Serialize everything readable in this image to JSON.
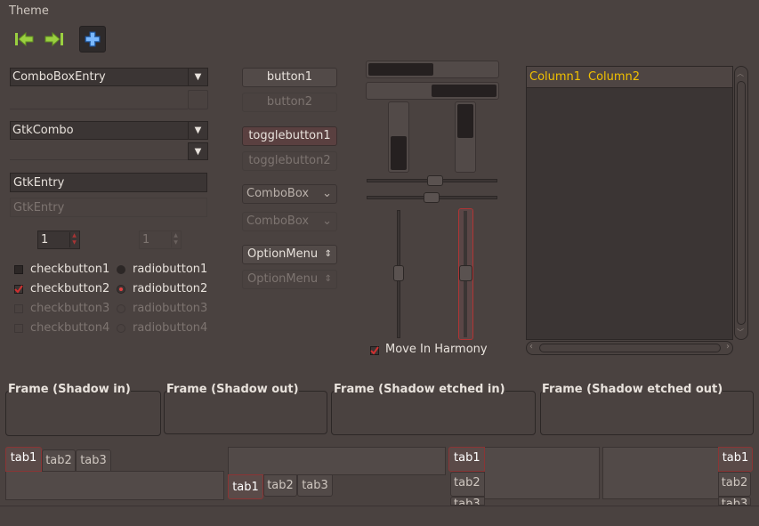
{
  "window": {
    "title": "Theme"
  },
  "toolbar": {
    "back_icon": "go-first-icon",
    "forward_icon": "go-last-icon",
    "add_icon": "add-icon"
  },
  "left": {
    "combo_entry_value": "ComboBoxEntry",
    "gtk_combo_value": "GtkCombo",
    "entry1_value": "GtkEntry",
    "entry2_value": "GtkEntry",
    "spin1_value": "1",
    "spin2_value": "1",
    "checks": [
      "checkbutton1",
      "checkbutton2",
      "checkbutton3",
      "checkbutton4"
    ],
    "radios": [
      "radiobutton1",
      "radiobutton2",
      "radiobutton3",
      "radiobutton4"
    ]
  },
  "middle": {
    "button1": "button1",
    "button2": "button2",
    "toggle1": "togglebutton1",
    "toggle2": "togglebutton2",
    "combo1": "ComboBox",
    "combo2": "ComboBox",
    "option1": "OptionMenu",
    "option2": "OptionMenu"
  },
  "scales": {
    "harmony_label": "Move In Harmony",
    "progress_h1": 0.5,
    "progress_h2": 0.5,
    "progress_v1": 0.5,
    "progress_v2": 0.5
  },
  "tree": {
    "columns": [
      "Column1",
      "Column2"
    ]
  },
  "frames": [
    "Frame (Shadow in)",
    "Frame (Shadow out)",
    "Frame (Shadow etched in)",
    "Frame (Shadow etched out)"
  ],
  "tabs": [
    "tab1",
    "tab2",
    "tab3"
  ],
  "colors": {
    "accent": "#a83434",
    "column_header_text": "#f0c000",
    "bg": "#4a4240"
  }
}
